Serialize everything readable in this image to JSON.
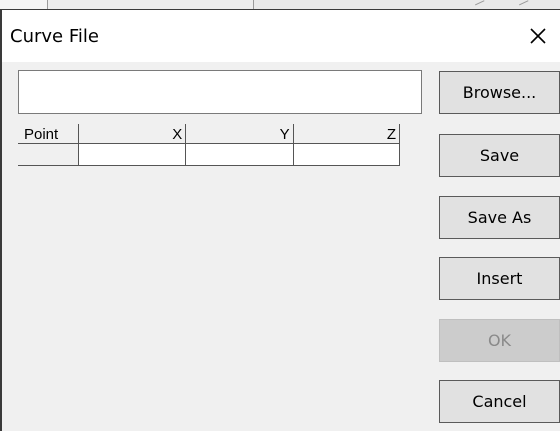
{
  "dialog": {
    "title": "Curve File",
    "close_icon": "close-icon"
  },
  "file": {
    "path_value": "",
    "placeholder": ""
  },
  "table": {
    "columns": [
      "Point",
      "X",
      "Y",
      "Z"
    ],
    "rows": [
      [
        "",
        "",
        "",
        ""
      ]
    ]
  },
  "buttons": {
    "browse": "Browse...",
    "save": "Save",
    "save_as": "Save As",
    "insert": "Insert",
    "ok": "OK",
    "cancel": "Cancel"
  },
  "state": {
    "ok_enabled": false
  }
}
